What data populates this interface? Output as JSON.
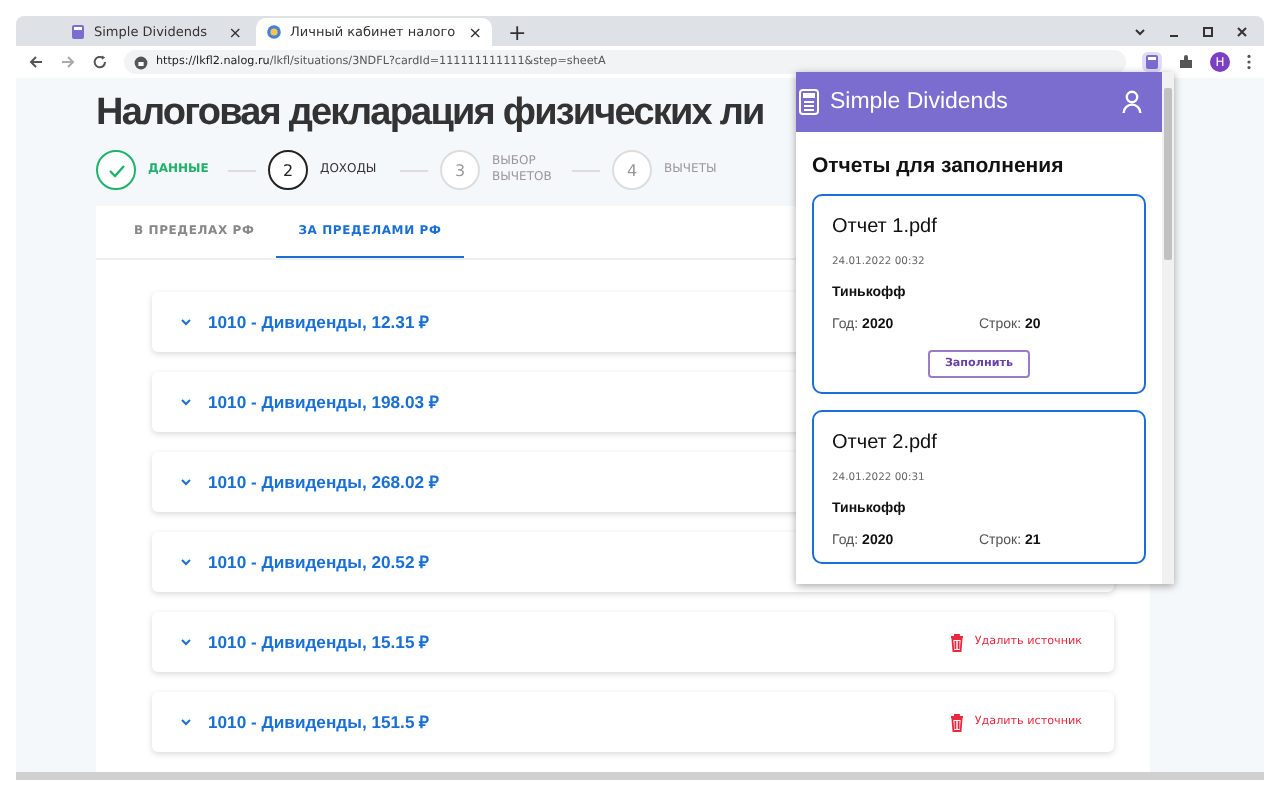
{
  "browser": {
    "tabs": [
      {
        "title": "Simple Dividends",
        "close": "×",
        "selected": false
      },
      {
        "title": "Личный кабинет налого",
        "close": "×",
        "selected": true
      }
    ],
    "new_tab": "+",
    "url_host": "https://lkfl2.nalog.ru",
    "url_path": "/lkfl/situations/3NDFL?cardId=111111111111&step=sheetA",
    "profile_initial": "H"
  },
  "page": {
    "title": "Налоговая декларация физических ли",
    "steps": [
      {
        "label": "ДАННЫЕ",
        "completed": true,
        "current": false
      },
      {
        "number": "2",
        "label": "ДОХОДЫ",
        "completed": false,
        "current": true
      },
      {
        "number": "3",
        "label": "ВЫБОР ВЫЧЕТОВ",
        "completed": false,
        "current": false
      },
      {
        "number": "4",
        "label": "ВЫЧЕТЫ",
        "completed": false,
        "current": false
      }
    ],
    "tabs": [
      {
        "label": "В ПРЕДЕЛАХ РФ",
        "selected": false
      },
      {
        "label": "ЗА ПРЕДЕЛАМИ РФ",
        "selected": true
      }
    ],
    "incomes": [
      {
        "label": "1010 - Дивиденды, 12.31 ₽"
      },
      {
        "label": "1010 - Дивиденды, 198.03 ₽"
      },
      {
        "label": "1010 - Дивиденды, 268.02 ₽"
      },
      {
        "label": "1010 - Дивиденды, 20.52 ₽"
      },
      {
        "label": "1010 - Дивиденды, 15.15 ₽",
        "delete_label": "Удалить источник"
      },
      {
        "label": "1010 - Дивиденды, 151.5 ₽",
        "delete_label": "Удалить источник"
      }
    ]
  },
  "popup": {
    "title": "Simple Dividends",
    "heading": "Отчеты для заполнения",
    "reports": [
      {
        "name": "Отчет 1.pdf",
        "date": "24.01.2022 00:32",
        "broker": "Тинькофф",
        "year_label": "Год:",
        "year": "2020",
        "rows_label": "Строк:",
        "rows": "20",
        "button": "Заполнить"
      },
      {
        "name": "Отчет 2.pdf",
        "date": "24.01.2022 00:31",
        "broker": "Тинькофф",
        "year_label": "Год:",
        "year": "2020",
        "rows_label": "Строк:",
        "rows": "21"
      }
    ]
  }
}
